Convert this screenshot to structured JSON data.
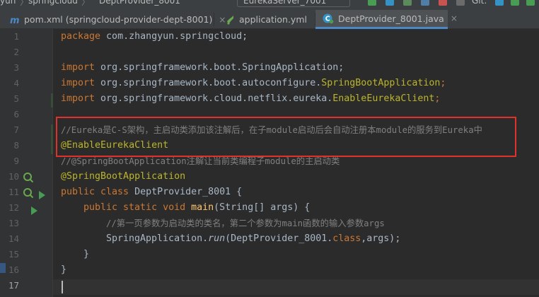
{
  "top_strip": {
    "crumb_1": "yun",
    "crumb_2": "springcloud",
    "crumb_3": "DeptProvider_8001",
    "run_config": "EurekaServer_7001",
    "git_label": "Git:"
  },
  "tabs": [
    {
      "icon": "maven-icon",
      "label": "pom.xml (springcloud-provider-dept-8001)",
      "active": false
    },
    {
      "icon": "yaml-file-icon",
      "label": "application.yml",
      "active": false
    },
    {
      "icon": "java-class-icon",
      "label": "DeptProvider_8001.java",
      "active": true
    }
  ],
  "tab_close_glyph": "×",
  "line_numbers": [
    "1",
    "2",
    "3",
    "4",
    "5",
    "6",
    "7",
    "8",
    "9",
    "10",
    "11",
    "12",
    "13",
    "14",
    "15",
    "16",
    "17"
  ],
  "current_line": "17",
  "code": {
    "l1_kw": "package",
    "l1_rest": " com.zhangyun.springcloud;",
    "l3_kw": "import",
    "l3_rest": " org.springframework.boot.SpringApplication;",
    "l4_kw": "import",
    "l4_rest_a": " org.springframework.boot.autoconfigure.",
    "l4_rest_b": "SpringBootApplication",
    "l4_rest_c": ";",
    "l5_kw": "import",
    "l5_rest_a": " org.springframework.cloud.netflix.eureka.",
    "l5_rest_b": "EnableEurekaClient",
    "l5_rest_c": ";",
    "l7_comment": "//Eureka是C-S架构，主启动类添加该注解后，在子module启动后会自动注册本module的服务到Eureka中",
    "l8_annotation": "@EnableEurekaClient",
    "l9_comment": "//@SpringBootApplication注解让当前类编程子module的主启动类",
    "l10_annotation": "@SpringBootApplication",
    "l11_kw": "public class",
    "l11_rest": " DeptProvider_8001 {",
    "l12_kw": "public static void",
    "l12_fn": "main",
    "l12_rest": "(String[] args) {",
    "l13_comment": "//第一页参数为启动类的类名，第二个参数为main函数的输入参数args",
    "l14_a": "SpringApplication.",
    "l14_run": "run",
    "l14_b": "(DeptProvider_8001.",
    "l14_kw": "class",
    "l14_c": ",args);",
    "l15": "}",
    "l16": "}"
  },
  "colors": {
    "keyword": "#cc7832",
    "annotation": "#bbb529",
    "comment": "#808080",
    "function": "#ffc66d",
    "text": "#a9b7c6",
    "highlight_box": "#e0312d"
  },
  "gutter_icons": {
    "line_10": "spring-bean-icon",
    "line_11": [
      "spring-bean-icon",
      "run-icon"
    ],
    "line_12": "run-icon"
  }
}
